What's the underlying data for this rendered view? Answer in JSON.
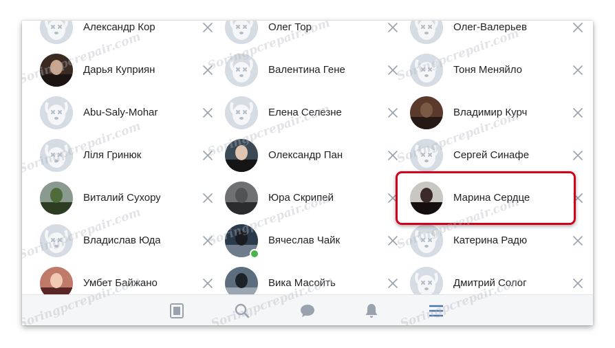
{
  "watermark": "Soringpcrepair.com",
  "rows": [
    [
      {
        "name": "Александр Кор",
        "avatar": "default-avatar"
      },
      {
        "name": "Олег Тор",
        "avatar": "default-avatar"
      },
      {
        "name": "Олег-Валерьев",
        "avatar": "default-avatar"
      }
    ],
    [
      {
        "name": "Дарья Куприян",
        "avatar": "photo-avatar"
      },
      {
        "name": "Валентина Гене",
        "avatar": "default-avatar"
      },
      {
        "name": "Тоня Меняйло",
        "avatar": "default-avatar"
      }
    ],
    [
      {
        "name": "Abu-Saly-Mohar",
        "avatar": "default-avatar"
      },
      {
        "name": "Елена Селезне",
        "avatar": "default-avatar"
      },
      {
        "name": "Владимир Курч",
        "avatar": "photo-avatar"
      }
    ],
    [
      {
        "name": "Ліля Гринюк",
        "avatar": "default-avatar"
      },
      {
        "name": "Олександр Пан",
        "avatar": "photo-avatar"
      },
      {
        "name": "Сергей Синафе",
        "avatar": "default-avatar"
      }
    ],
    [
      {
        "name": "Виталий Сухору",
        "avatar": "photo-avatar"
      },
      {
        "name": "Юра Скрипей",
        "avatar": "photo-avatar"
      },
      {
        "name": "Марина Сердце",
        "avatar": "photo-avatar",
        "highlighted": true
      }
    ],
    [
      {
        "name": "Владислав Юда",
        "avatar": "default-avatar"
      },
      {
        "name": "Вячеслав Чайк",
        "avatar": "photo-avatar",
        "online": true
      },
      {
        "name": "Катерина Радю",
        "avatar": "default-avatar"
      }
    ],
    [
      {
        "name": "Умбет Байжано",
        "avatar": "photo-avatar"
      },
      {
        "name": "Вика Масойть",
        "avatar": "photo-avatar"
      },
      {
        "name": "Дмитрий Солог",
        "avatar": "default-avatar"
      }
    ]
  ],
  "tabbar": [
    {
      "icon": "news-icon",
      "active": false
    },
    {
      "icon": "search-icon",
      "active": false
    },
    {
      "icon": "messages-icon",
      "active": false
    },
    {
      "icon": "notifications-icon",
      "active": false
    },
    {
      "icon": "menu-icon",
      "active": true
    }
  ],
  "colors": {
    "text": "#222222",
    "remove_icon": "#99a2ad",
    "tab_icon": "#99a2ad",
    "tab_active": "#4a76a8",
    "highlight_border": "#d0021b",
    "online": "#4bb34b"
  }
}
